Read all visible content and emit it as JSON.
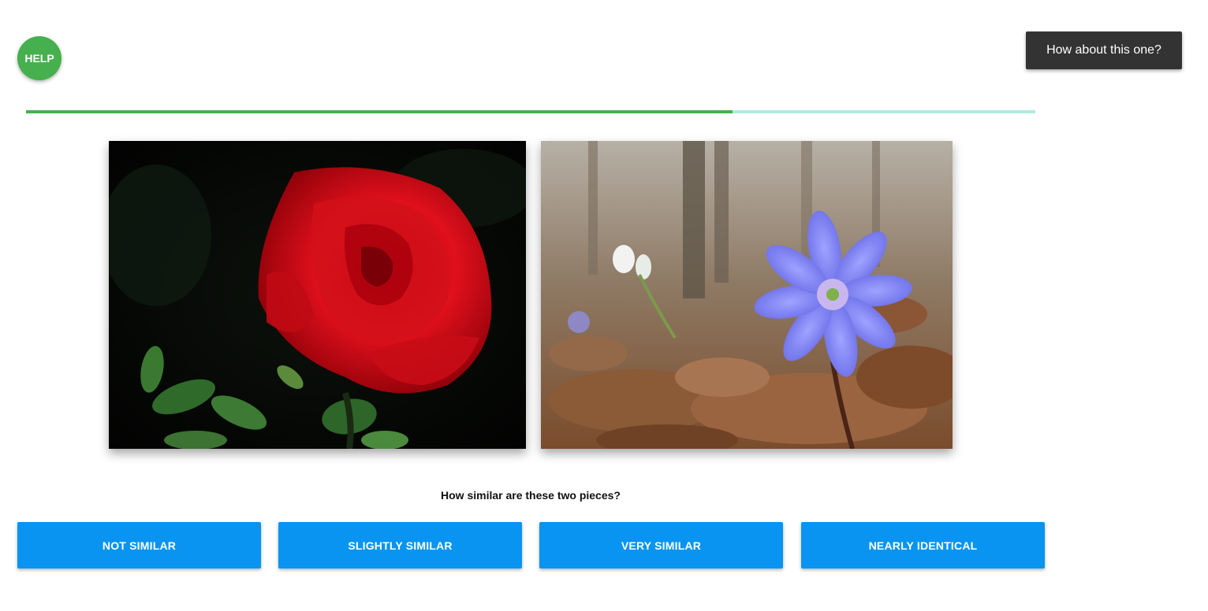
{
  "header": {
    "help_label": "HELP",
    "next_label": "How about this one?"
  },
  "progress": {
    "fraction": 0.7,
    "fill_color": "#46b04e",
    "track_color": "#aeeae0"
  },
  "artworks": {
    "left": {
      "subject": "red-rose"
    },
    "right": {
      "subject": "blue-hepatica-flower"
    }
  },
  "rating": {
    "question": "How similar are these two pieces?",
    "options": [
      {
        "label": "NOT SIMILAR"
      },
      {
        "label": "SLIGHTLY SIMILAR"
      },
      {
        "label": "VERY SIMILAR"
      },
      {
        "label": "NEARLY IDENTICAL"
      }
    ],
    "button_color": "#0894f0"
  }
}
